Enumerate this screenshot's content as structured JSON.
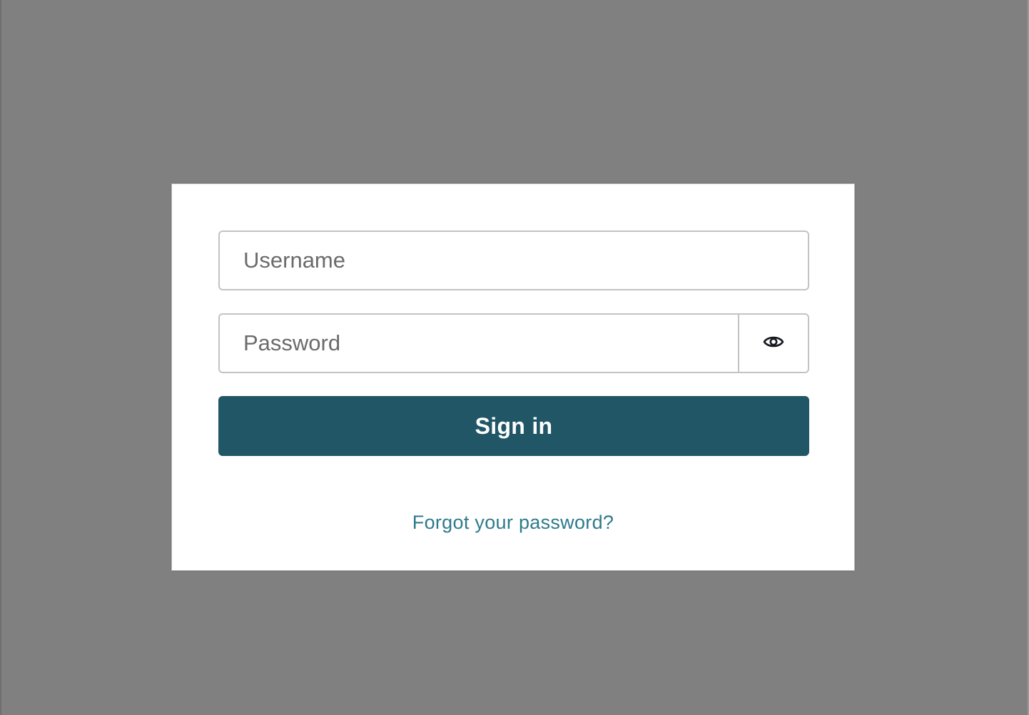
{
  "login": {
    "username_placeholder": "Username",
    "password_placeholder": "Password",
    "toggle_password_icon": "eye-icon",
    "signin_label": "Sign in",
    "forgot_password_label": "Forgot your password?"
  },
  "colors": {
    "backdrop": "#808080",
    "card_background": "#ffffff",
    "primary_button": "#215667",
    "link": "#2e7a8c"
  }
}
